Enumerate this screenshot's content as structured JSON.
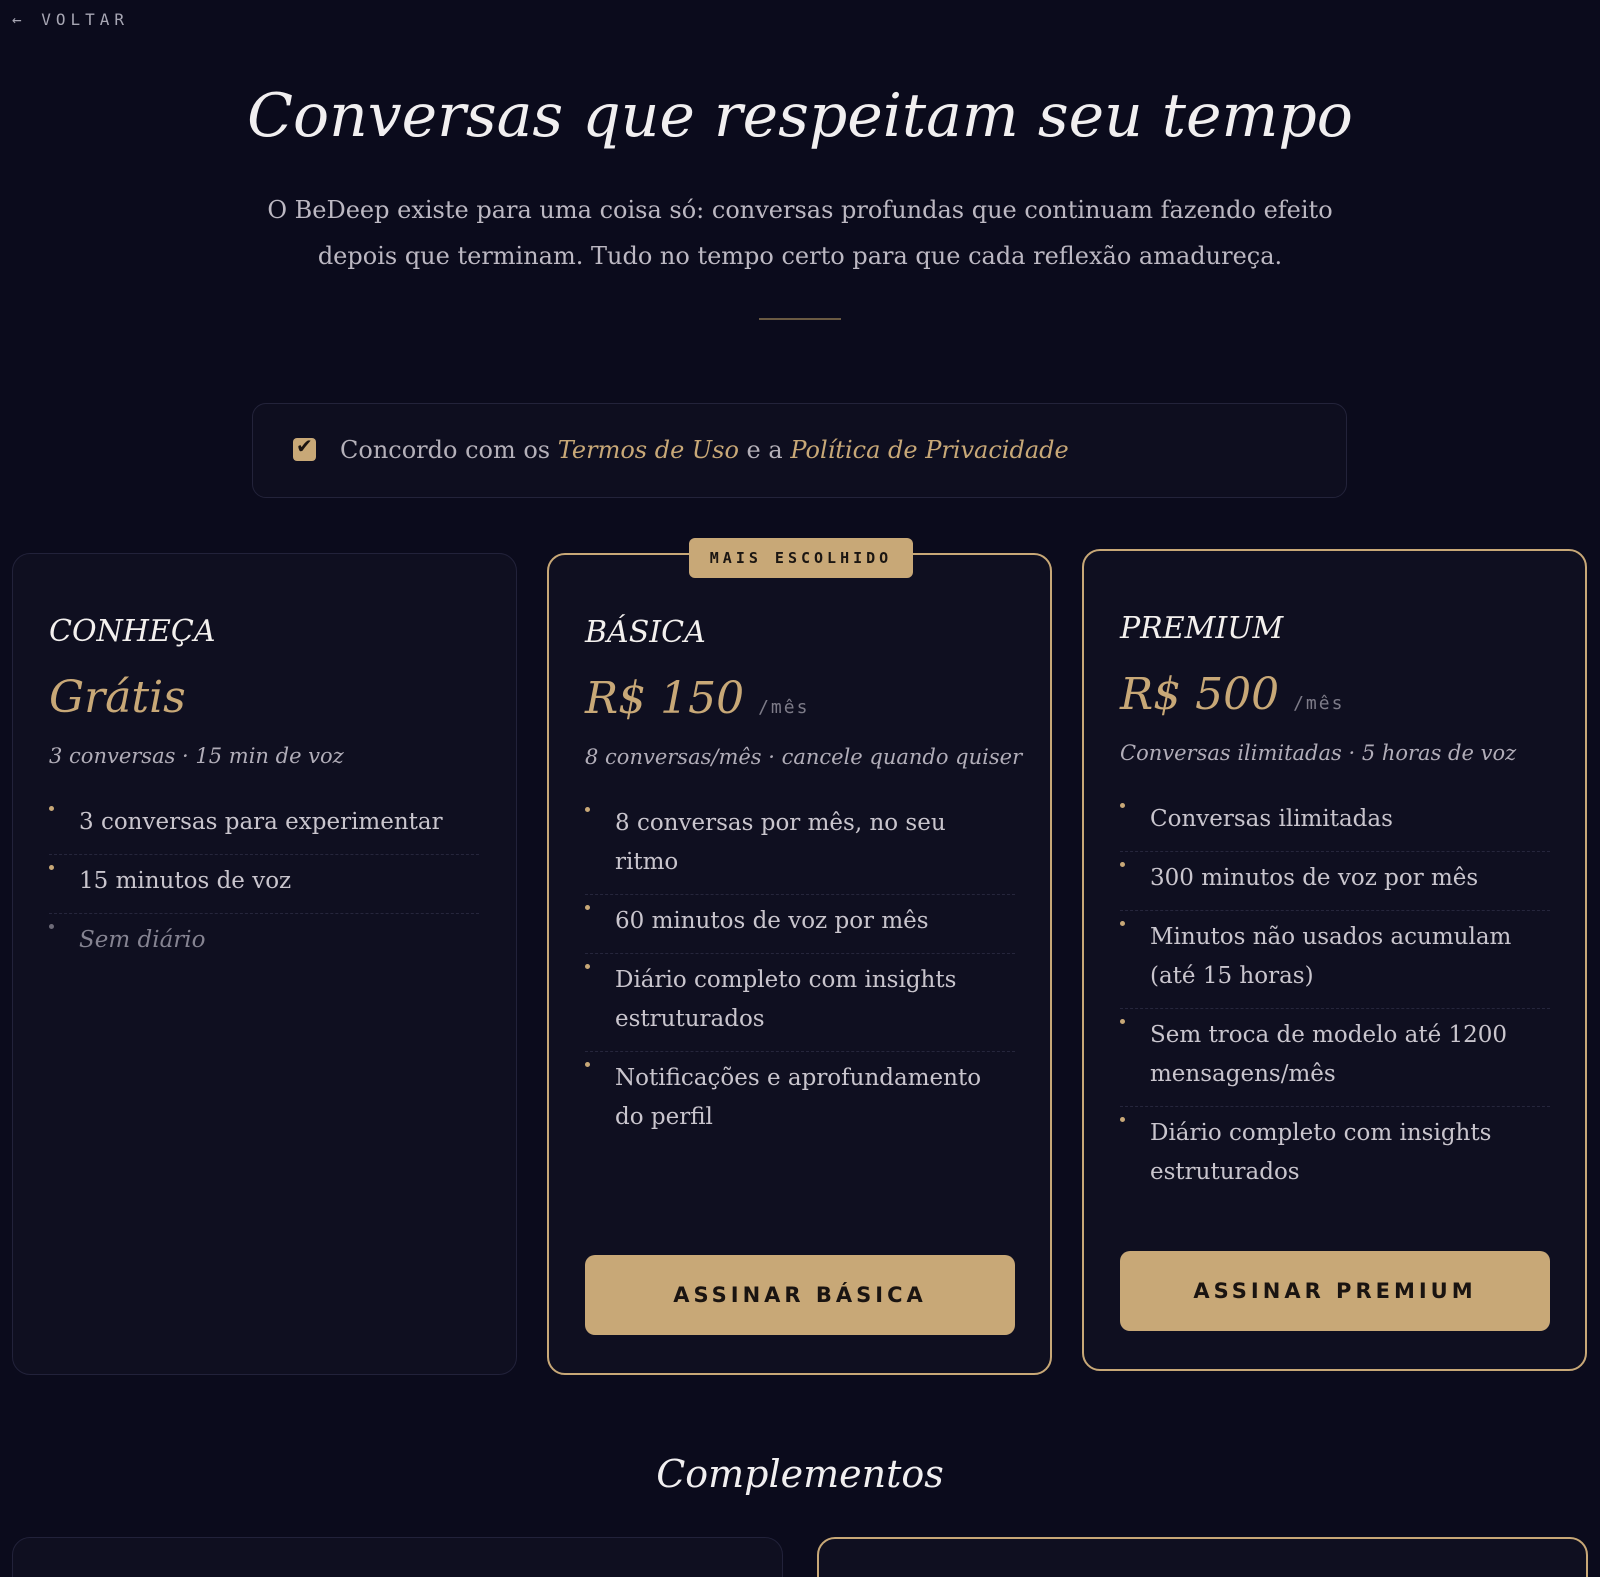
{
  "nav": {
    "back_label": "← VOLTAR"
  },
  "hero": {
    "title": "Conversas que respeitam seu tempo",
    "subtitle": "O BeDeep existe para uma coisa só: conversas profundas que continuam fazendo efeito depois que terminam. Tudo no tempo certo para que cada reflexão amadureça."
  },
  "terms": {
    "checked": true,
    "checkmark": "✔",
    "text_prefix": "Concordo com os ",
    "terms_link": "Termos de Uso",
    "connector": " e a ",
    "privacy_link": "Política de Privacidade"
  },
  "plans": [
    {
      "name": "CONHEÇA",
      "price": "Grátis",
      "period": "",
      "summary": "3 conversas · 15 min de voz",
      "badge": "",
      "features": [
        "3 conversas para experimentar",
        "15 minutos de voz",
        "Sem diário"
      ],
      "button": ""
    },
    {
      "name": "BÁSICA",
      "price": "R$ 150",
      "period": "/mês",
      "summary": "8 conversas/mês · cancele quando quiser",
      "badge": "MAIS ESCOLHIDO",
      "features": [
        "8 conversas por mês, no seu ritmo",
        "60 minutos de voz por mês",
        "Diário completo com insights estruturados",
        "Notificações e aprofundamento do perfil"
      ],
      "button": "ASSINAR BÁSICA"
    },
    {
      "name": "PREMIUM",
      "price": "R$ 500",
      "period": "/mês",
      "summary": "Conversas ilimitadas · 5 horas de voz",
      "badge": "",
      "features": [
        "Conversas ilimitadas",
        "300 minutos de voz por mês",
        "Minutos não usados acumulam (até 15 horas)",
        "Sem troca de modelo até 1200 mensagens/mês",
        "Diário completo com insights estruturados"
      ],
      "button": "ASSINAR PREMIUM"
    }
  ],
  "addons": {
    "title": "Complementos"
  },
  "colors": {
    "background": "#0b0b1c",
    "card": "#0f0f20",
    "accent": "#c8a877",
    "text": "#d8d4cf"
  }
}
